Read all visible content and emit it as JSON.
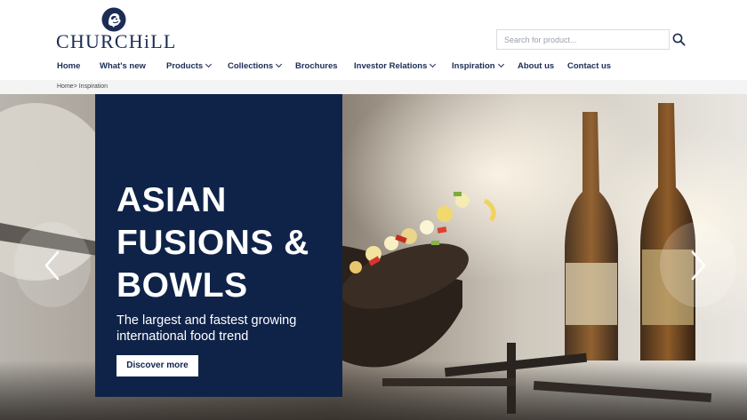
{
  "brand": {
    "logo_text": "CHURCHiLL",
    "logo_icon": "lion-crest-icon"
  },
  "search": {
    "placeholder": "Search for product...",
    "icon": "search-icon"
  },
  "nav": {
    "items": [
      {
        "label": "Home",
        "has_dropdown": false
      },
      {
        "label": "What's new",
        "has_dropdown": false
      },
      {
        "label": "Products",
        "has_dropdown": true
      },
      {
        "label": "Collections",
        "has_dropdown": true
      },
      {
        "label": "Brochures",
        "has_dropdown": false
      },
      {
        "label": "Investor Relations",
        "has_dropdown": true
      },
      {
        "label": "Inspiration",
        "has_dropdown": true
      },
      {
        "label": "About us",
        "has_dropdown": false
      },
      {
        "label": "Contact us",
        "has_dropdown": false
      }
    ]
  },
  "breadcrumb": {
    "home": "Home",
    "separator": ">",
    "current": "Inspiration"
  },
  "hero": {
    "title": "ASIAN\nFUSIONS &\nBOWLS",
    "subtitle": "The largest and fastest growing international food trend",
    "button_label": "Discover more",
    "prev_icon": "chevron-left-icon",
    "next_icon": "chevron-right-icon"
  },
  "colors": {
    "navy": "#0f2349",
    "brand": "#1b2c55",
    "breadcrumb_bg": "#f4f4f5"
  }
}
